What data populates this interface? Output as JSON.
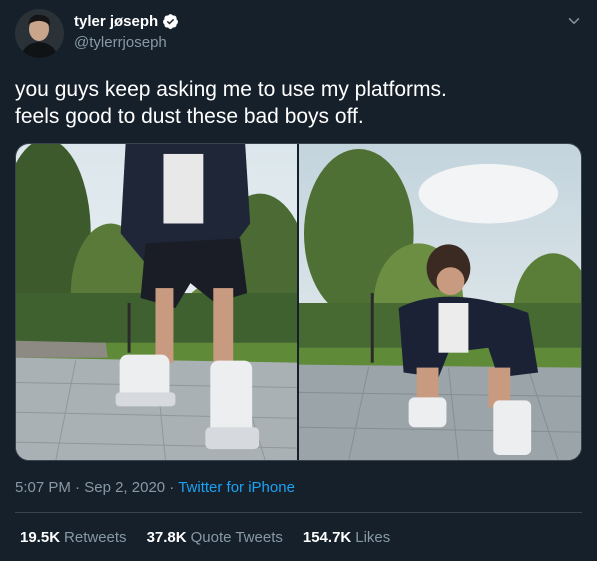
{
  "author": {
    "display_name": "tyler jøseph",
    "handle": "@tylerrjoseph",
    "verified": true,
    "avatar_icon": "avatar-photo"
  },
  "tweet": {
    "text_lines": [
      "you guys keep asking me to use my platforms.",
      "feels good to dust these bad boys off."
    ]
  },
  "media": {
    "photos": [
      {
        "description_icon": "platform-shoes-photo-standing"
      },
      {
        "description_icon": "platform-shoes-photo-crouching"
      }
    ]
  },
  "meta": {
    "time": "5:07 PM",
    "separator1": " · ",
    "date": "Sep 2, 2020",
    "separator2": " · ",
    "source": "Twitter for iPhone"
  },
  "stats": {
    "retweets_count": "19.5K",
    "retweets_label": "Retweets",
    "quote_count": "37.8K",
    "quote_label": "Quote Tweets",
    "likes_count": "154.7K",
    "likes_label": "Likes"
  },
  "colors": {
    "background": "#15202b",
    "secondary_text": "#8899a6",
    "link": "#1da1f2",
    "border": "#38444d"
  }
}
